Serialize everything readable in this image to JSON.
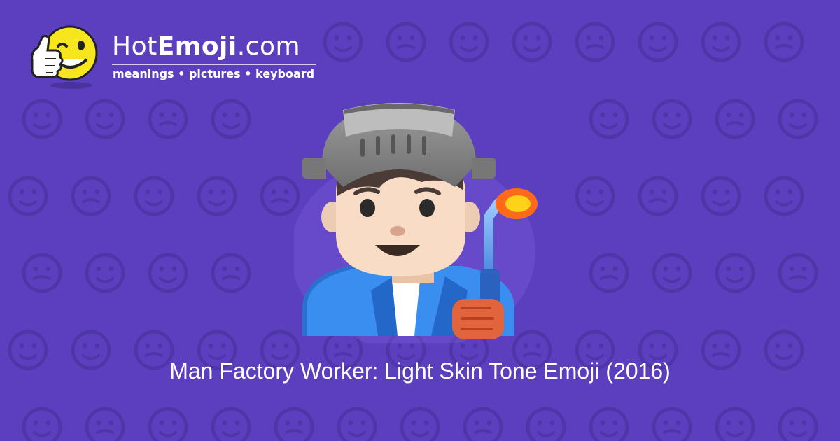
{
  "brand": {
    "name_light": "Hot",
    "name_bold": "Emoji",
    "name_suffix": ".com",
    "tagline": "meanings • pictures • keyboard"
  },
  "emoji": {
    "title": "Man Factory Worker: Light Skin Tone Emoji (2016)"
  },
  "colors": {
    "background": "#5b3fbf",
    "pattern": "#4f36a8",
    "text": "#ffffff"
  },
  "icons": {
    "logo": "winking-thumbs-up-face-icon",
    "hero": "man-factory-worker-light-skin-tone-icon"
  }
}
